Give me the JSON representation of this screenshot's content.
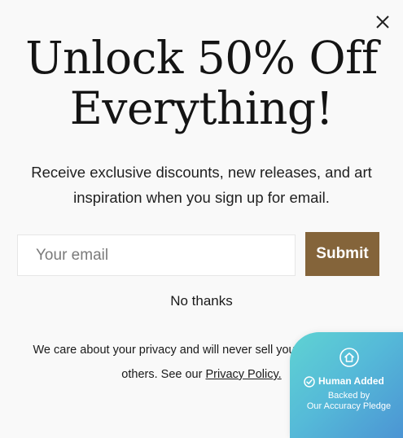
{
  "popup": {
    "close_icon": "close-icon",
    "headline": "Unlock 50% Off Everything!",
    "subtext": "Receive exclusive discounts, new releases, and art inspiration when you sign up for email.",
    "email_placeholder": "Your email",
    "email_value": "",
    "submit_label": "Submit",
    "no_thanks_label": "No thanks",
    "privacy_text": "We care about your privacy and will never sell you information to others. See our",
    "privacy_link": "Privacy Policy.",
    "colors": {
      "submit_bg": "#84643a",
      "background": "#f9f9f9"
    }
  },
  "badge": {
    "icon": "house-shield-icon",
    "check_icon": "check-circle-icon",
    "title": "Human Added",
    "line1": "Backed by",
    "line2": "Our Accuracy Pledge",
    "colors": {
      "gradient_start": "#5fd3d3",
      "gradient_end": "#4a8fd3"
    }
  }
}
